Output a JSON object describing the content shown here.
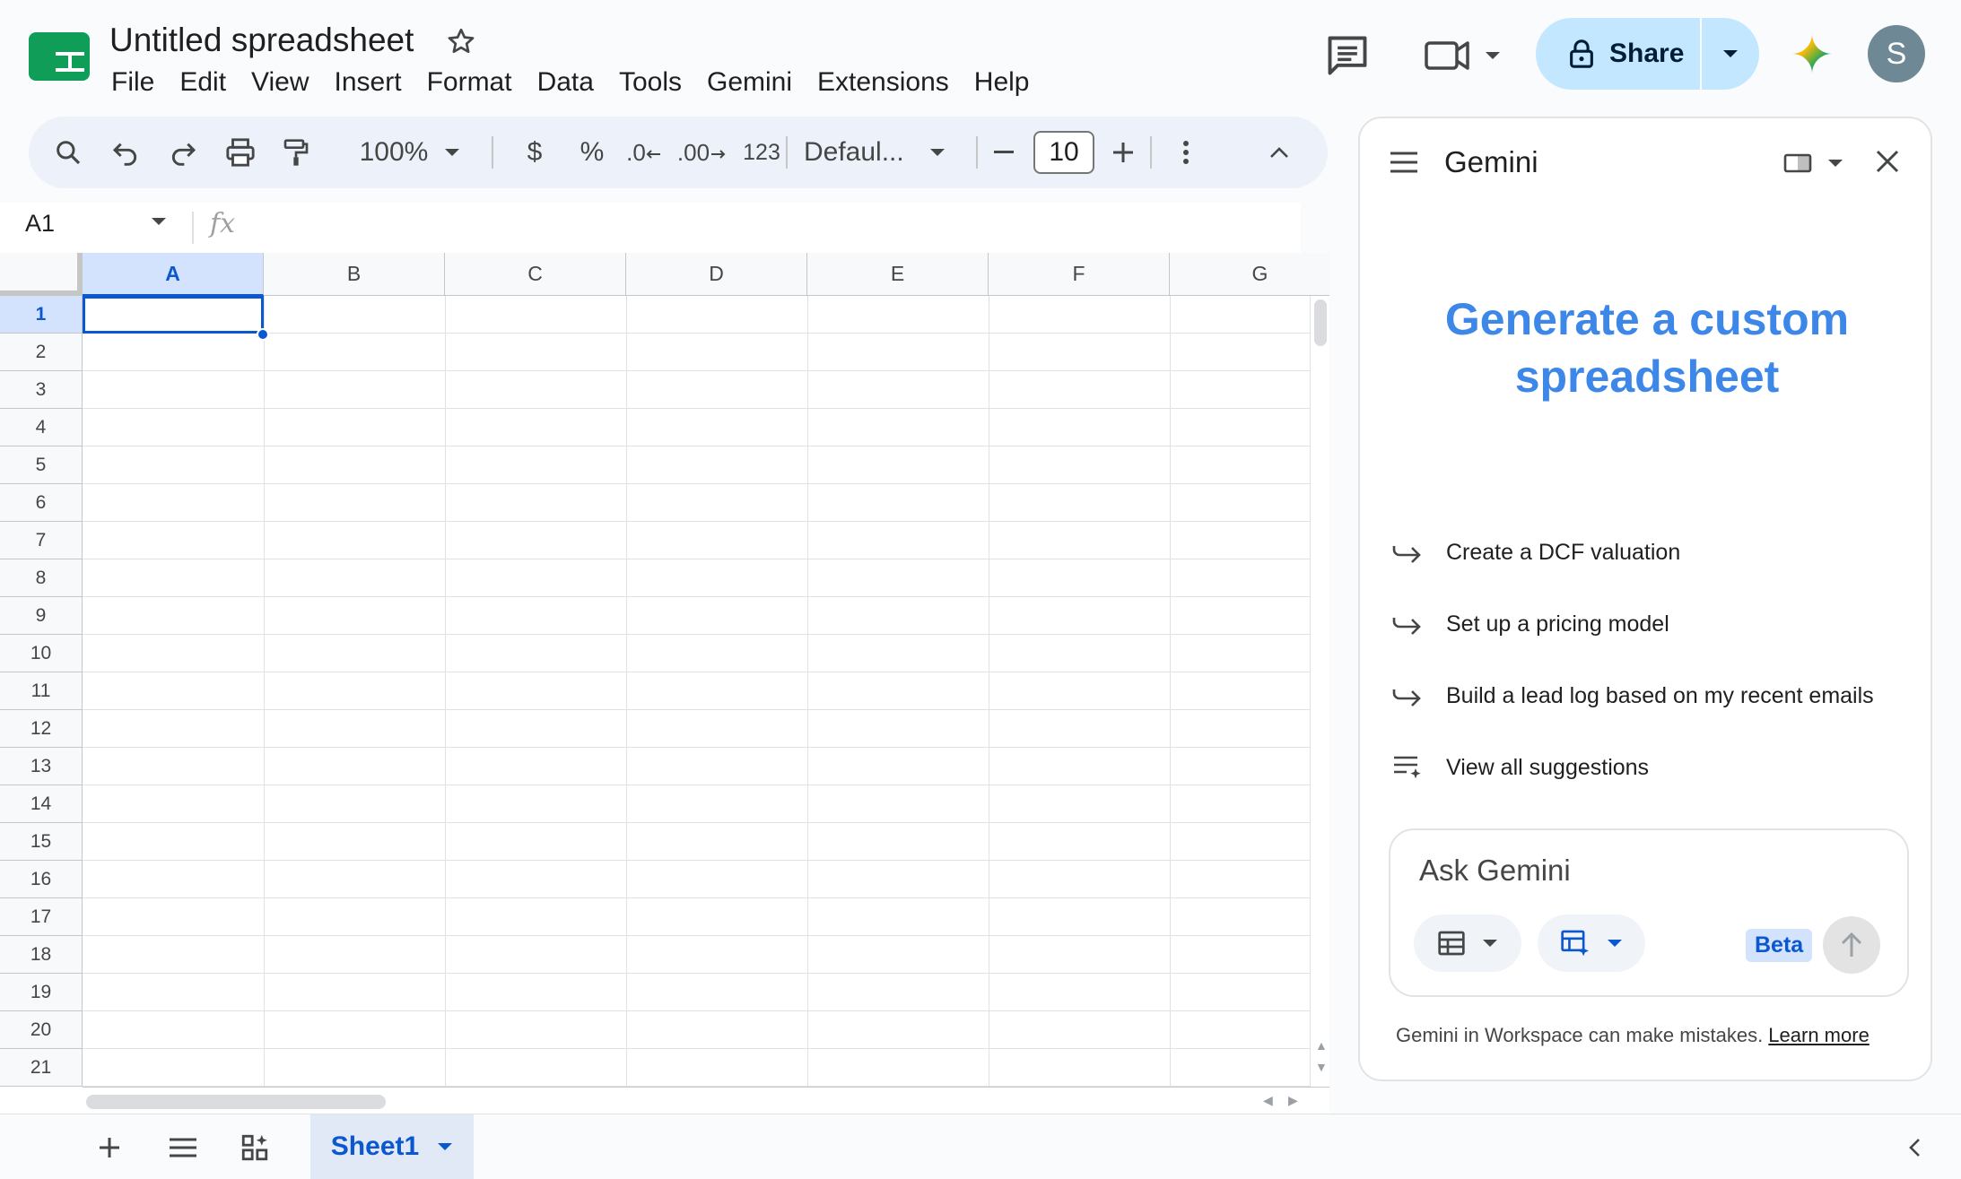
{
  "header": {
    "title": "Untitled spreadsheet",
    "menu": [
      "File",
      "Edit",
      "View",
      "Insert",
      "Format",
      "Data",
      "Tools",
      "Gemini",
      "Extensions",
      "Help"
    ],
    "share_label": "Share",
    "avatar_initial": "S"
  },
  "toolbar": {
    "zoom": "100%",
    "currency": "$",
    "percent": "%",
    "decrease_decimal": ".0",
    "increase_decimal": ".00",
    "number_format": "123",
    "font": "Defaul...",
    "font_size": "10"
  },
  "formula_bar": {
    "cell_ref": "A1",
    "fx": "fx",
    "content": ""
  },
  "grid": {
    "columns": [
      "A",
      "B",
      "C",
      "D",
      "E",
      "F",
      "G"
    ],
    "rows": [
      "1",
      "2",
      "3",
      "4",
      "5",
      "6",
      "7",
      "8",
      "9",
      "10",
      "11",
      "12",
      "13",
      "14",
      "15",
      "16",
      "17",
      "18",
      "19",
      "20",
      "21"
    ],
    "selected_cell": "A1"
  },
  "sheets": {
    "active": "Sheet1"
  },
  "gemini": {
    "title": "Gemini",
    "headline": "Generate a custom spreadsheet",
    "suggestions": [
      {
        "icon": "arrow-turn-right-icon",
        "label": "Create a DCF valuation"
      },
      {
        "icon": "arrow-turn-right-icon",
        "label": "Set up a pricing model"
      },
      {
        "icon": "arrow-turn-right-icon",
        "label": "Build a lead log based on my recent emails"
      },
      {
        "icon": "list-sparkle-icon",
        "label": "View all suggestions"
      }
    ],
    "input_placeholder": "Ask Gemini",
    "beta_label": "Beta",
    "disclaimer": "Gemini in Workspace can make mistakes.",
    "learn_more": "Learn more"
  },
  "colors": {
    "accent": "#0b57d0",
    "share_bg": "#c2e7ff",
    "headline": "#3d87e8",
    "sheets_green": "#0f9d58"
  }
}
